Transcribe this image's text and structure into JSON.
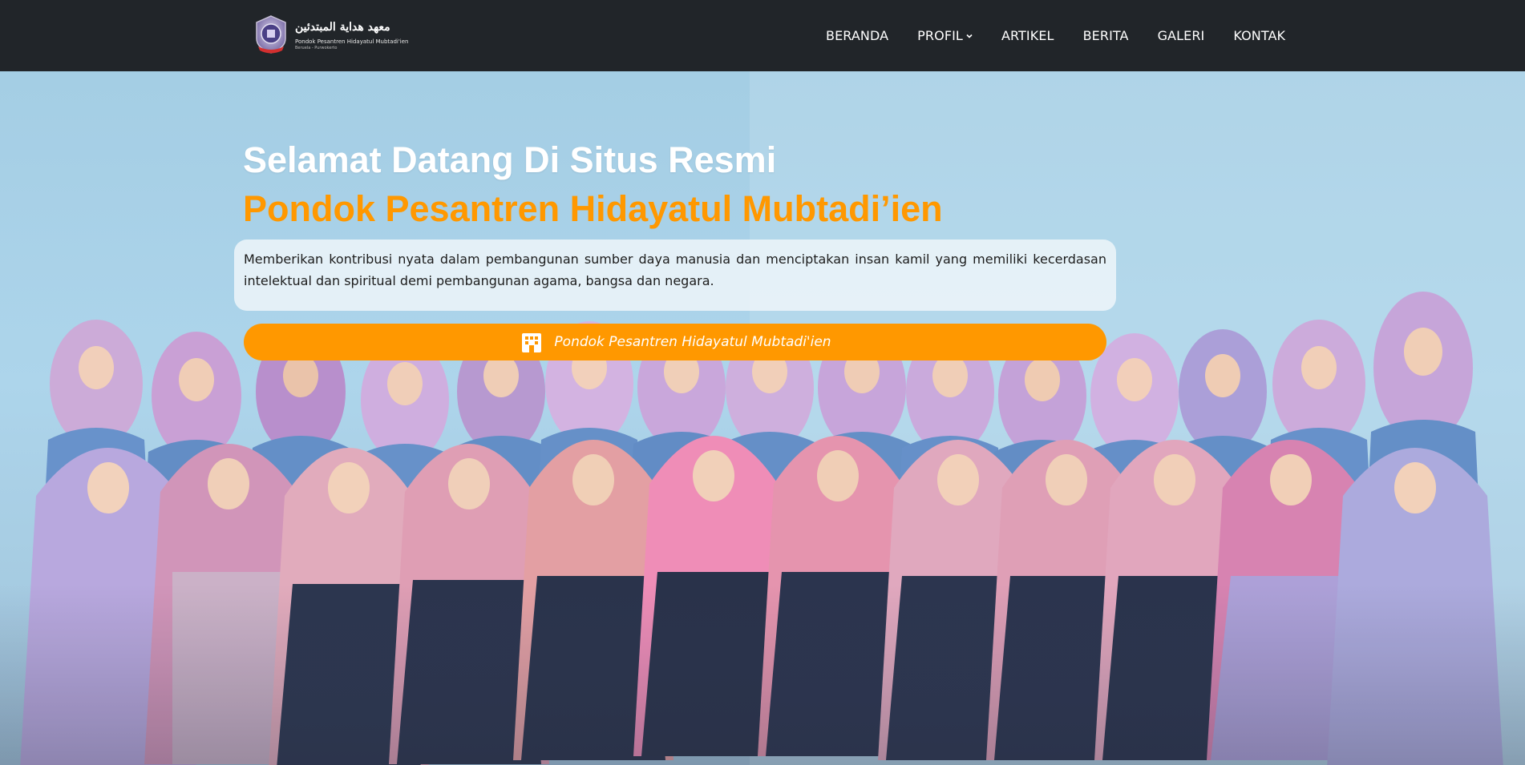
{
  "header": {
    "logo_arabic": "معهد هداية المبتدئين",
    "logo_name": "Pondok Pesantren Hidayatul Mubtadi'ien",
    "logo_sub": "Beruela - Purwokerto",
    "nav": [
      {
        "label": "BERANDA"
      },
      {
        "label": "PROFIL"
      },
      {
        "label": "ARTIKEL"
      },
      {
        "label": "BERITA"
      },
      {
        "label": "GALERI"
      },
      {
        "label": "KONTAK"
      }
    ]
  },
  "hero": {
    "title_line1": "Selamat Datang Di Situs Resmi",
    "title_line2": "Pondok Pesantren Hidayatul Mubtadi’ien",
    "mission": "Memberikan kontribusi nyata dalam pembangunan sumber daya manusia dan menciptakan insan kamil yang memiliki kecerdasan intelektual dan spiritual demi pembangunan agama, bangsa dan negara.",
    "cta_label": "Pondok Pesantren Hidayatul Mubtadi'ien",
    "cta_icon": "building-icon"
  },
  "colors": {
    "navbar_bg": "#212529",
    "accent": "#ff9800",
    "nav_text": "#ffffff"
  }
}
